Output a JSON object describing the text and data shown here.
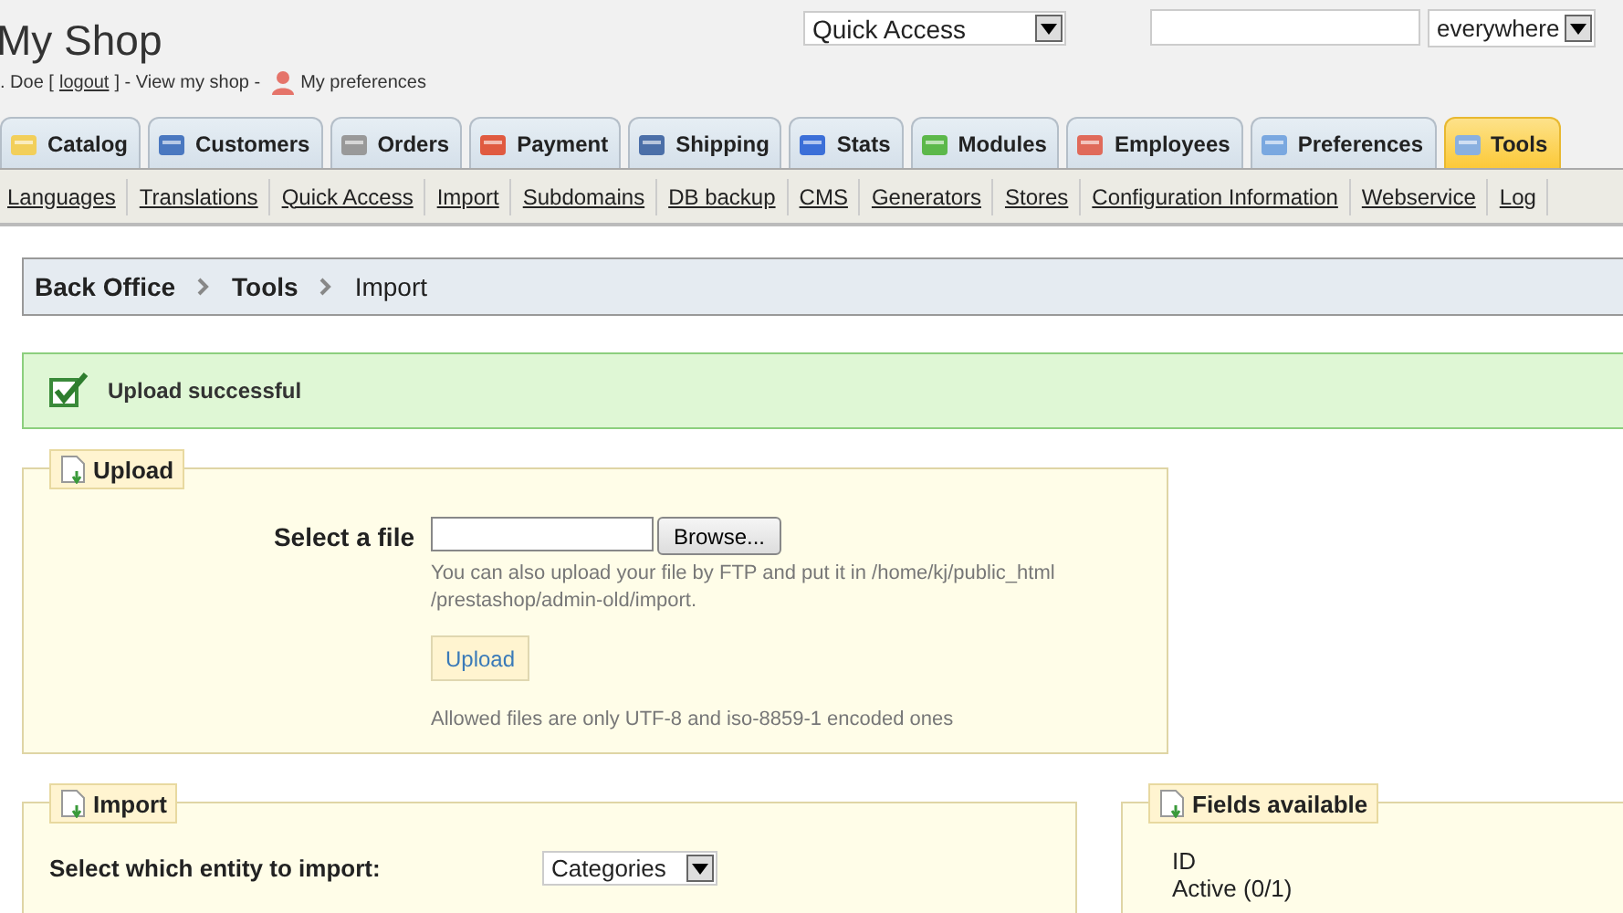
{
  "header": {
    "shop_name": "My Shop",
    "quick_access": "Quick Access",
    "search_scope": "everywhere",
    "user_prefix": ". Doe [",
    "logout": "logout",
    "user_suffix": "] - View my shop -",
    "preferences": "My preferences"
  },
  "tabs": [
    {
      "label": "Catalog",
      "selected": false
    },
    {
      "label": "Customers",
      "selected": false
    },
    {
      "label": "Orders",
      "selected": false
    },
    {
      "label": "Payment",
      "selected": false
    },
    {
      "label": "Shipping",
      "selected": false
    },
    {
      "label": "Stats",
      "selected": false
    },
    {
      "label": "Modules",
      "selected": false
    },
    {
      "label": "Employees",
      "selected": false
    },
    {
      "label": "Preferences",
      "selected": false
    },
    {
      "label": "Tools",
      "selected": true
    }
  ],
  "submenu": [
    "Languages",
    "Translations",
    "Quick Access",
    "Import",
    "Subdomains",
    "DB backup",
    "CMS",
    "Generators",
    "Stores",
    "Configuration Information",
    "Webservice",
    "Log"
  ],
  "breadcrumb": [
    "Back Office",
    "Tools",
    "Import"
  ],
  "success_message": "Upload successful",
  "upload": {
    "legend": "Upload",
    "file_label": "Select a file",
    "browse": "Browse...",
    "hint": "You can also upload your file by FTP and put it in /home/kj/public_html /prestashop/admin-old/import.",
    "button": "Upload",
    "note": "Allowed files are only UTF-8 and iso-8859-1 encoded ones"
  },
  "import": {
    "legend": "Import",
    "entity_label": "Select which entity to import:",
    "entity": "Categories"
  },
  "fields": {
    "legend": "Fields available",
    "items": [
      "ID",
      "Active (0/1)"
    ]
  }
}
